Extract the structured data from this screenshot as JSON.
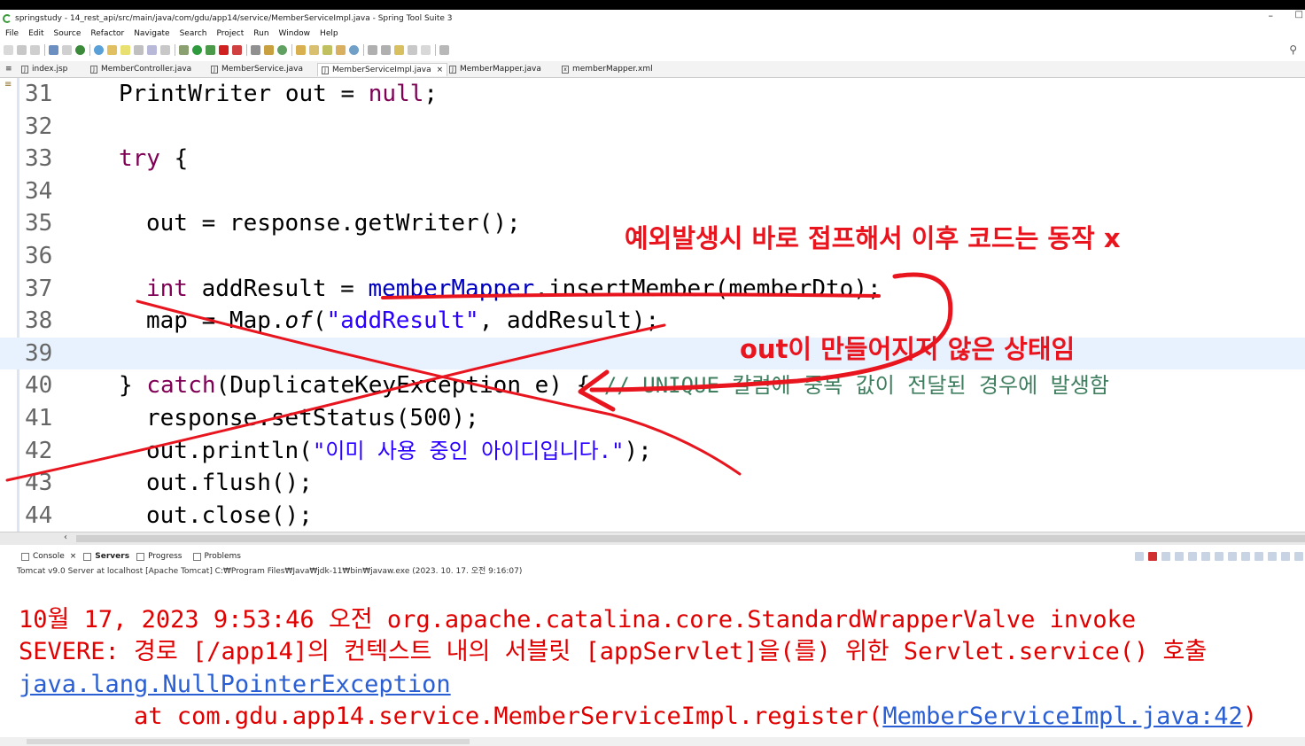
{
  "window": {
    "title": "springstudy - 14_rest_api/src/main/java/com/gdu/app14/service/MemberServiceImpl.java - Spring Tool Suite 3",
    "minimize": "–",
    "restore": "□"
  },
  "menu": [
    "File",
    "Edit",
    "Source",
    "Refactor",
    "Navigate",
    "Search",
    "Project",
    "Run",
    "Window",
    "Help"
  ],
  "tabs": [
    {
      "label": "index.jsp",
      "icon": "J"
    },
    {
      "label": "MemberController.java",
      "icon": "J"
    },
    {
      "label": "MemberService.java",
      "icon": "J"
    },
    {
      "label": "MemberServiceImpl.java",
      "icon": "J",
      "active": true
    },
    {
      "label": "MemberMapper.java",
      "icon": "J"
    },
    {
      "label": "memberMapper.xml",
      "icon": "x"
    }
  ],
  "code": {
    "line_numbers": [
      "31",
      "32",
      "33",
      "34",
      "35",
      "36",
      "37",
      "38",
      "39",
      "40",
      "41",
      "42",
      "43",
      "44"
    ],
    "l31": {
      "type": "PrintWriter",
      "var": " out = ",
      "null": "null",
      "end": ";"
    },
    "l33": {
      "kw": "try",
      "rest": " {"
    },
    "l35": {
      "a": "out = response.getWriter();"
    },
    "l37": {
      "kw": "int",
      "a": " addResult = ",
      "field": "memberMapper",
      "b": ".insertMember(memberDto);"
    },
    "l38": {
      "a": "map = Map.",
      "it": "of",
      "b": "(",
      "str": "\"addResult\"",
      "c": ", addResult);"
    },
    "l40": {
      "a": "} ",
      "kw": "catch",
      "b": "(DuplicateKeyException e) { ",
      "comment": "// UNIQUE 칼럼에 중복 값이 전달된 경우에 발생함"
    },
    "l41": {
      "a": "response.setStatus(500);"
    },
    "l42": {
      "a": "out.println(",
      "str": "\"이미 사용 중인 아이디입니다.\"",
      "b": ");"
    },
    "l43": {
      "a": "out.flush();"
    },
    "l44": {
      "a": "out.close();"
    }
  },
  "views": {
    "tabs": [
      "Console",
      "Servers",
      "Progress",
      "Problems"
    ],
    "console_close": "×",
    "console_desc": "Tomcat v9.0 Server at localhost [Apache Tomcat] C:₩Program Files₩Java₩jdk-11₩bin₩javaw.exe  (2023. 10. 17. 오전 9:16:07)"
  },
  "console": {
    "line1": "10월 17, 2023 9:53:46 오전 org.apache.catalina.core.StandardWrapperValve invoke",
    "line2": "SEVERE: 경로 [/app14]의 컨텍스트 내의 서블릿 [appServlet]을(를) 위한 Servlet.service() 호출",
    "line3": "java.lang.NullPointerException",
    "line4_prefix": "        at com.gdu.app14.service.MemberServiceImpl.register(",
    "line4_link": "MemberServiceImpl.java:42",
    "line4_suffix": ")"
  },
  "annotations": {
    "note1": "예외발생시 바로 접프해서 이후 코드는 동작 x",
    "note2": "out이 만들어지지 않은 상태임"
  },
  "colors": {
    "annotation": "#e8141e",
    "keyword": "#7f0055",
    "string": "#2a00ff",
    "field": "#0000c0",
    "comment": "#3f7f5f",
    "console_error": "#e00000"
  }
}
